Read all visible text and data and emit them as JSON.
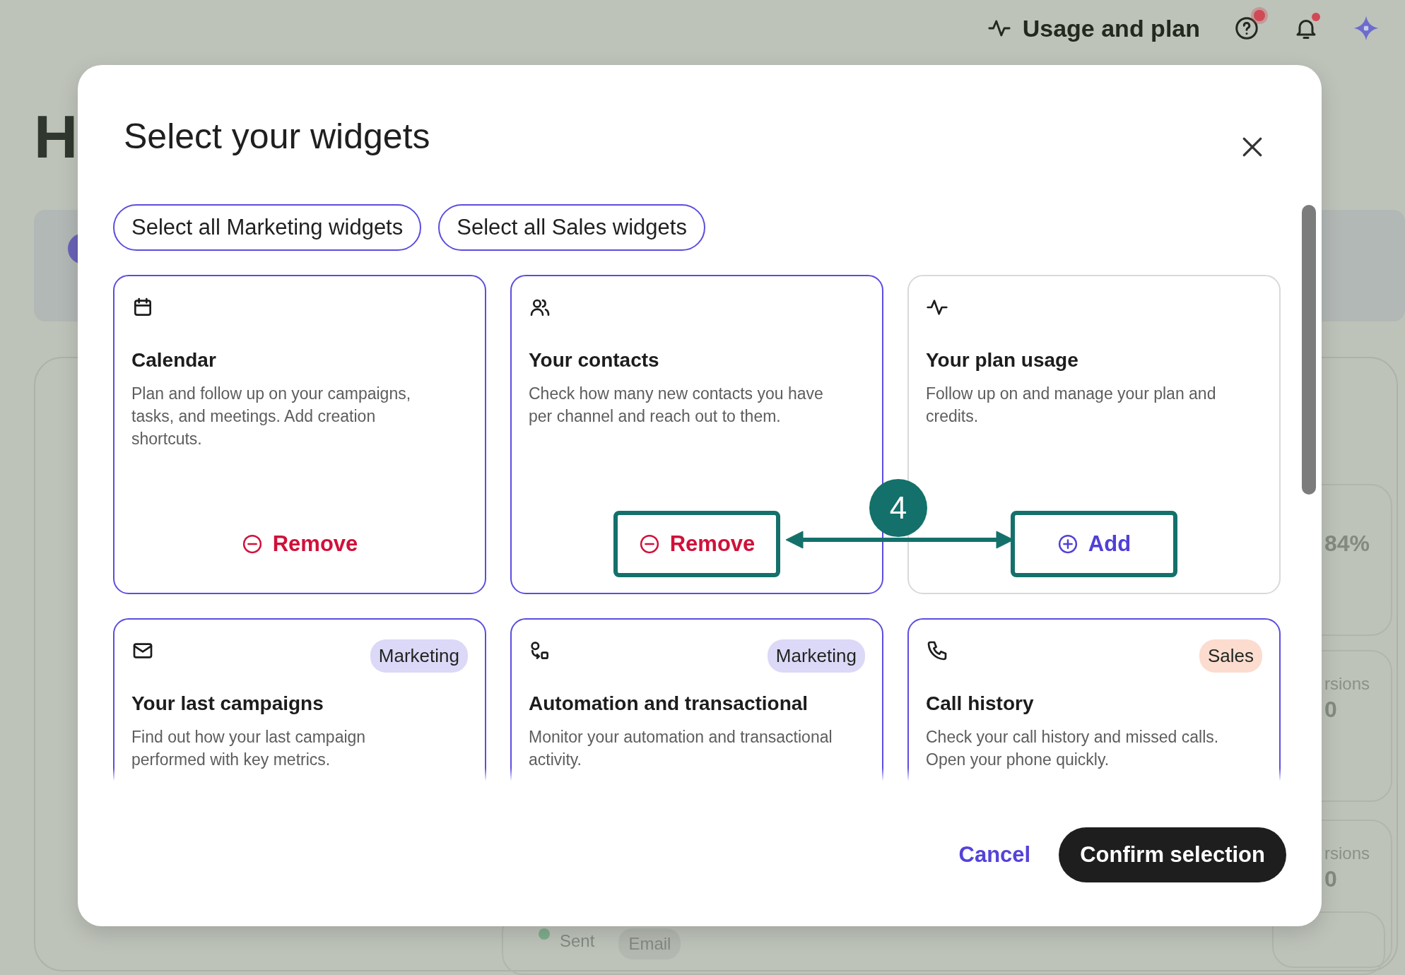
{
  "top_bar": {
    "usage_label": "Usage and plan"
  },
  "background": {
    "heading": "H",
    "stats": [
      {
        "value": "84%"
      },
      {
        "label": "rsions",
        "value": "0"
      },
      {
        "label": "rsions",
        "value": "0"
      }
    ],
    "legend": {
      "label": "Sent",
      "color": "#7fae8e"
    },
    "tag": "Email"
  },
  "dialog": {
    "title": "Select your widgets",
    "select_buttons": [
      "Select all Marketing widgets",
      "Select all Sales widgets"
    ],
    "widgets": [
      {
        "kind": "calendar",
        "title": "Calendar",
        "description": "Plan and follow up on your campaigns, tasks, and meetings. Add creation shortcuts.",
        "selected": true,
        "action": "Remove"
      },
      {
        "kind": "contacts",
        "title": "Your contacts",
        "description": "Check how many new contacts you have per channel and reach out to them.",
        "selected": true,
        "action": "Remove",
        "highlighted": true
      },
      {
        "kind": "pulse",
        "title": "Your plan usage",
        "description": "Follow up on and manage your plan and credits.",
        "selected": false,
        "action": "Add",
        "highlighted": true
      },
      {
        "kind": "mail",
        "title": "Your last campaigns",
        "description": "Find out how your last campaign performed with key metrics.",
        "selected": true,
        "tag": {
          "text": "Marketing",
          "kind": "marketing"
        }
      },
      {
        "kind": "automation",
        "title": "Automation and transactional",
        "description": "Monitor your automation and transactional activity.",
        "selected": true,
        "tag": {
          "text": "Marketing",
          "kind": "marketing"
        }
      },
      {
        "kind": "phone",
        "title": "Call history",
        "description": "Check your call history and missed calls. Open your phone quickly.",
        "selected": true,
        "tag": {
          "text": "Sales",
          "kind": "sales"
        }
      }
    ],
    "cancel": "Cancel",
    "confirm": "Confirm selection"
  },
  "annotation": {
    "step": "4"
  }
}
